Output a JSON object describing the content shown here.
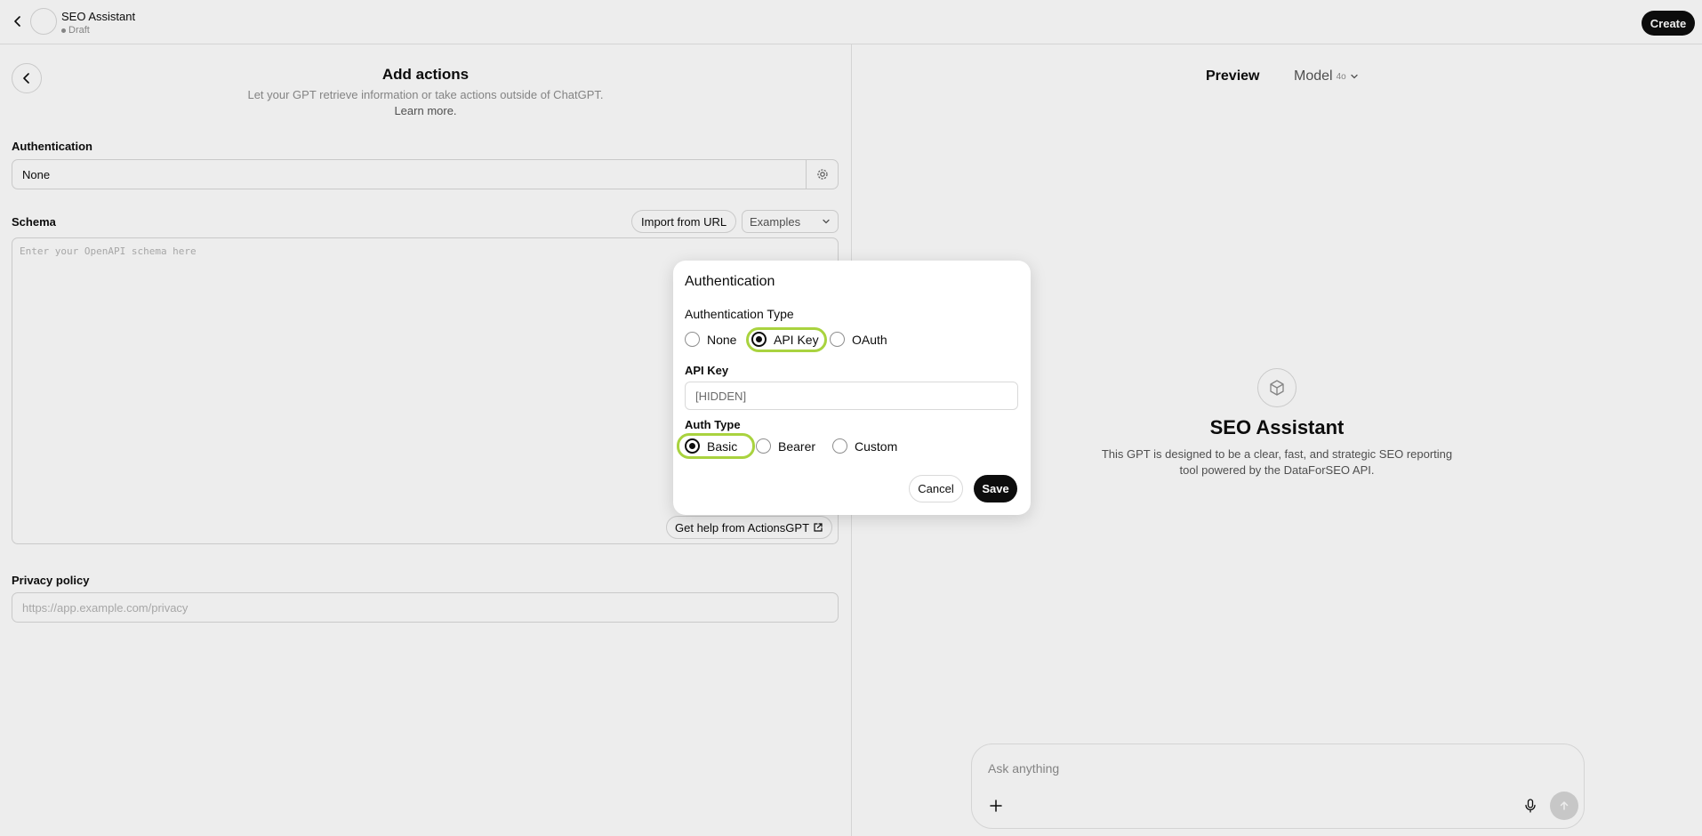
{
  "header": {
    "gpt_name": "SEO Assistant",
    "status": "Draft",
    "create_label": "Create"
  },
  "left": {
    "title": "Add actions",
    "subtitle": "Let your GPT retrieve information or take actions outside of ChatGPT.",
    "learn_more": "Learn more.",
    "authentication_label": "Authentication",
    "authentication_value": "None",
    "schema_label": "Schema",
    "import_label": "Import from URL",
    "examples_label": "Examples",
    "schema_placeholder": "Enter your OpenAPI schema here",
    "help_label": "Get help from ActionsGPT",
    "privacy_label": "Privacy policy",
    "privacy_placeholder": "https://app.example.com/privacy"
  },
  "right": {
    "preview_label": "Preview",
    "model_label": "Model",
    "model_version": "4o",
    "gpt_name": "SEO Assistant",
    "description": "This GPT is designed to be a clear, fast, and strategic SEO reporting tool powered by the DataForSEO API.",
    "chat_placeholder": "Ask anything"
  },
  "modal": {
    "title": "Authentication",
    "auth_type_label": "Authentication Type",
    "auth_types": [
      {
        "label": "None",
        "checked": false
      },
      {
        "label": "API Key",
        "checked": true
      },
      {
        "label": "OAuth",
        "checked": false
      }
    ],
    "api_key_label": "API Key",
    "api_key_value": "[HIDDEN]",
    "auth_subtype_label": "Auth Type",
    "auth_subtypes": [
      {
        "label": "Basic",
        "checked": true
      },
      {
        "label": "Bearer",
        "checked": false
      },
      {
        "label": "Custom",
        "checked": false
      }
    ],
    "cancel_label": "Cancel",
    "save_label": "Save"
  },
  "colors": {
    "highlight": "#a9d33f",
    "primary": "#0d0d0d"
  }
}
